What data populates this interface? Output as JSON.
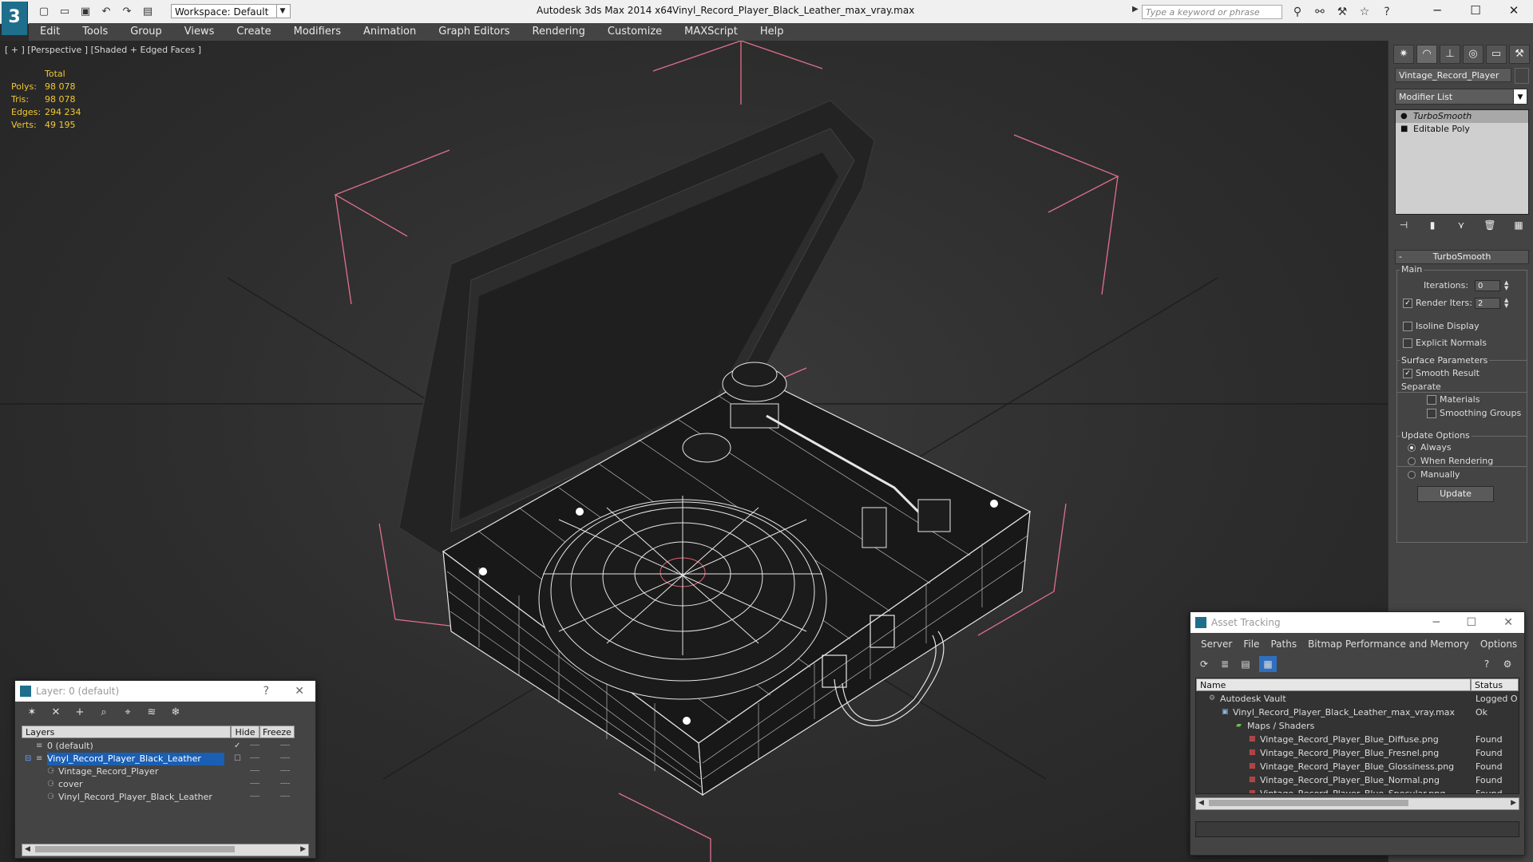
{
  "app": {
    "title": "Autodesk 3ds Max  2014 x64",
    "file": "Vinyl_Record_Player_Black_Leather_max_vray.max",
    "workspace": "Workspace: Default",
    "search_placeholder": "Type a keyword or phrase",
    "logo": "3"
  },
  "menu": [
    "Edit",
    "Tools",
    "Group",
    "Views",
    "Create",
    "Modifiers",
    "Animation",
    "Graph Editors",
    "Rendering",
    "Customize",
    "MAXScript",
    "Help"
  ],
  "viewport": {
    "label": "[ + ] [Perspective ] [Shaded + Edged Faces ]",
    "stats": {
      "header": "Total",
      "rows": [
        {
          "k": "Polys:",
          "v": "98 078"
        },
        {
          "k": "Tris:",
          "v": "98 078"
        },
        {
          "k": "Edges:",
          "v": "294 234"
        },
        {
          "k": "Verts:",
          "v": "49 195"
        }
      ]
    }
  },
  "command_panel": {
    "object_name": "Vintage_Record_Player",
    "modifier_list": "Modifier List",
    "stack": [
      "TurboSmooth",
      "Editable Poly"
    ],
    "rollout": "TurboSmooth",
    "main": {
      "title": "Main",
      "iterations_label": "Iterations:",
      "iterations": "0",
      "render_iters_label": "Render Iters:",
      "render_iters": "2",
      "render_iters_checked": true,
      "isoline": "Isoline Display",
      "explicit": "Explicit Normals"
    },
    "surface": {
      "title": "Surface Parameters",
      "smooth": "Smooth Result",
      "separate": "Separate",
      "materials": "Materials",
      "smoothing": "Smoothing Groups"
    },
    "update": {
      "title": "Update Options",
      "always": "Always",
      "when_rendering": "When Rendering",
      "manually": "Manually",
      "button": "Update"
    }
  },
  "layer_panel": {
    "title": "Layer: 0 (default)",
    "help": "?",
    "close": "✕",
    "columns": {
      "layers": "Layers",
      "hide": "Hide",
      "freeze": "Freeze"
    },
    "rows": [
      {
        "name": "0 (default)",
        "indent": 0,
        "selected": false,
        "check": true
      },
      {
        "name": "Vinyl_Record_Player_Black_Leather",
        "indent": 0,
        "selected": true,
        "check": false
      },
      {
        "name": "Vintage_Record_Player",
        "indent": 1,
        "selected": false,
        "check": false
      },
      {
        "name": "cover",
        "indent": 1,
        "selected": false,
        "check": false
      },
      {
        "name": "Vinyl_Record_Player_Black_Leather",
        "indent": 1,
        "selected": false,
        "check": false
      }
    ]
  },
  "asset_tracking": {
    "title": "Asset Tracking",
    "menu": [
      "Server",
      "File",
      "Paths",
      "Bitmap Performance and Memory",
      "Options"
    ],
    "columns": {
      "name": "Name",
      "status": "Status"
    },
    "rows": [
      {
        "name": "Autodesk Vault",
        "status": "Logged O",
        "indent": 0,
        "icon": "vault"
      },
      {
        "name": "Vinyl_Record_Player_Black_Leather_max_vray.max",
        "status": "Ok",
        "indent": 1,
        "icon": "max"
      },
      {
        "name": "Maps / Shaders",
        "status": "",
        "indent": 2,
        "icon": "folder"
      },
      {
        "name": "Vintage_Record_Player_Blue_Diffuse.png",
        "status": "Found",
        "indent": 3,
        "icon": "png"
      },
      {
        "name": "Vintage_Record_Player_Blue_Fresnel.png",
        "status": "Found",
        "indent": 3,
        "icon": "png"
      },
      {
        "name": "Vintage_Record_Player_Blue_Glossiness.png",
        "status": "Found",
        "indent": 3,
        "icon": "png"
      },
      {
        "name": "Vintage_Record_Player_Blue_Normal.png",
        "status": "Found",
        "indent": 3,
        "icon": "png"
      },
      {
        "name": "Vintage_Record_Player_Blue_Specular.png",
        "status": "Found",
        "indent": 3,
        "icon": "png"
      }
    ]
  },
  "colors": {
    "stats": "#f2c832",
    "wire": "#e6e6e6",
    "bbox": "#e0708c",
    "selection": "#1a5fb4"
  }
}
